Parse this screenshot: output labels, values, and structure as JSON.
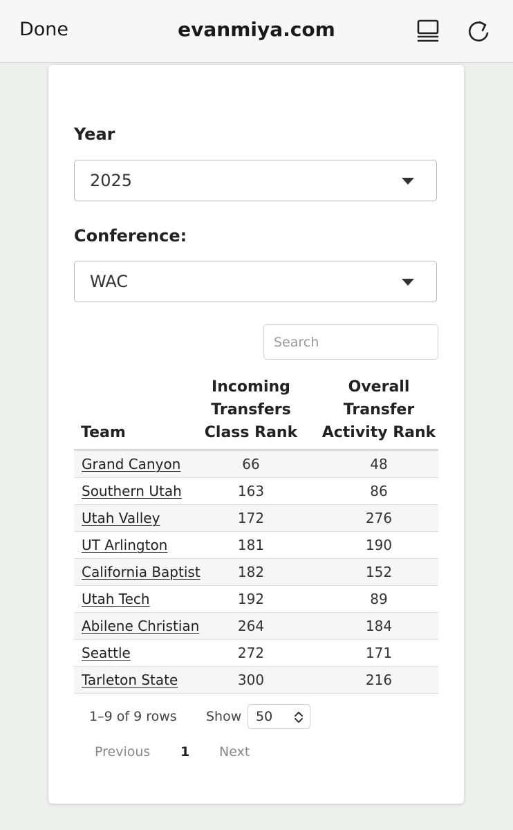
{
  "browser": {
    "done_label": "Done",
    "domain": "evanmiya.com",
    "reader_icon": "reader-icon",
    "reload_icon": "reload-icon"
  },
  "filters": {
    "year_label": "Year",
    "year_value": "2025",
    "conference_label": "Conference:",
    "conference_value": "WAC"
  },
  "search": {
    "placeholder": "Search"
  },
  "table": {
    "columns": {
      "team": "Team",
      "incoming": [
        "Incoming",
        "Transfers",
        "Class Rank"
      ],
      "overall": [
        "Overall",
        "Transfer",
        "Activity Rank"
      ]
    },
    "rows": [
      {
        "team": "Grand Canyon",
        "incoming": "66",
        "overall": "48"
      },
      {
        "team": "Southern Utah",
        "incoming": "163",
        "overall": "86"
      },
      {
        "team": "Utah Valley",
        "incoming": "172",
        "overall": "276"
      },
      {
        "team": "UT Arlington",
        "incoming": "181",
        "overall": "190"
      },
      {
        "team": "California Baptist",
        "incoming": "182",
        "overall": "152"
      },
      {
        "team": "Utah Tech",
        "incoming": "192",
        "overall": "89"
      },
      {
        "team": "Abilene Christian",
        "incoming": "264",
        "overall": "184"
      },
      {
        "team": "Seattle",
        "incoming": "272",
        "overall": "171"
      },
      {
        "team": "Tarleton State",
        "incoming": "300",
        "overall": "216"
      }
    ]
  },
  "pagination": {
    "row_info": "1–9 of 9 rows",
    "show_label": "Show",
    "page_size": "50",
    "previous": "Previous",
    "current_page": "1",
    "next": "Next"
  }
}
